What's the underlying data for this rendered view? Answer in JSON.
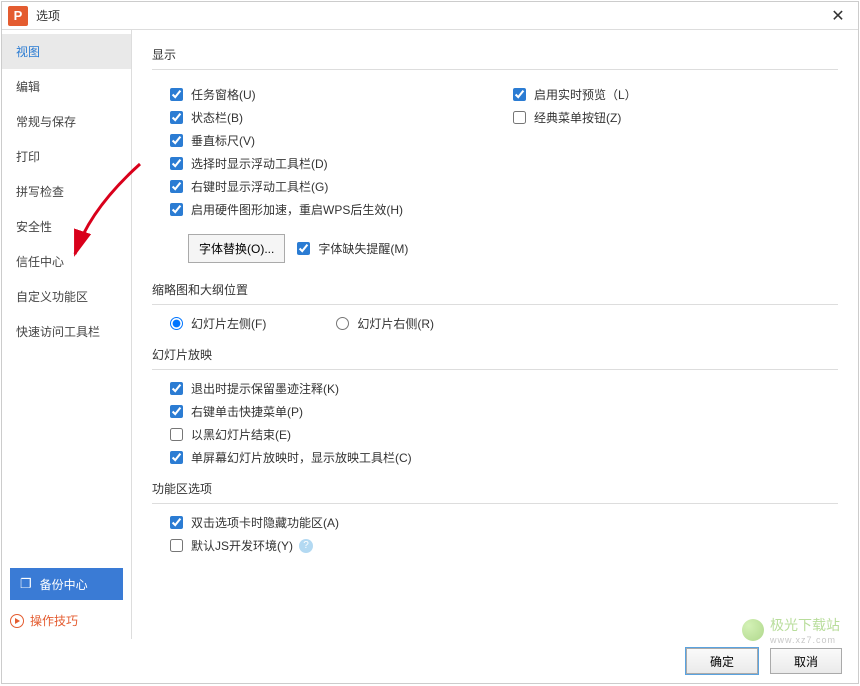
{
  "title": "选项",
  "app_icon_letter": "P",
  "sidebar": {
    "items": [
      {
        "label": "视图",
        "active": true
      },
      {
        "label": "编辑"
      },
      {
        "label": "常规与保存"
      },
      {
        "label": "打印"
      },
      {
        "label": "拼写检查"
      },
      {
        "label": "安全性"
      },
      {
        "label": "信任中心"
      },
      {
        "label": "自定义功能区"
      },
      {
        "label": "快速访问工具栏"
      }
    ],
    "backup_label": "备份中心",
    "tips_label": "操作技巧"
  },
  "sections": {
    "display": {
      "title": "显示",
      "task_pane": "任务窗格(U)",
      "realtime_preview": "启用实时预览（L）",
      "status_bar": "状态栏(B)",
      "classic_menu": "经典菜单按钮(Z)",
      "vertical_ruler": "垂直标尺(V)",
      "select_float_toolbar": "选择时显示浮动工具栏(D)",
      "rightclick_float_toolbar": "右键时显示浮动工具栏(G)",
      "hw_accel": "启用硬件图形加速，重启WPS后生效(H)",
      "font_replace_btn": "字体替换(O)...",
      "font_missing_hint": "字体缺失提醒(M)"
    },
    "thumb": {
      "title": "缩略图和大纲位置",
      "left": "幻灯片左侧(F)",
      "right": "幻灯片右侧(R)"
    },
    "slideshow": {
      "title": "幻灯片放映",
      "exit_prompt": "退出时提示保留墨迹注释(K)",
      "rightclick_menu": "右键单击快捷菜单(P)",
      "end_black": "以黑幻灯片结束(E)",
      "single_screen": "单屏幕幻灯片放映时，显示放映工具栏(C)"
    },
    "ribbon": {
      "title": "功能区选项",
      "dblclick_hide": "双击选项卡时隐藏功能区(A)",
      "default_js": "默认JS开发环境(Y)"
    }
  },
  "footer": {
    "ok": "确定",
    "cancel": "取消"
  },
  "watermark": {
    "name": "极光下载站",
    "url": "www.xz7.com"
  }
}
